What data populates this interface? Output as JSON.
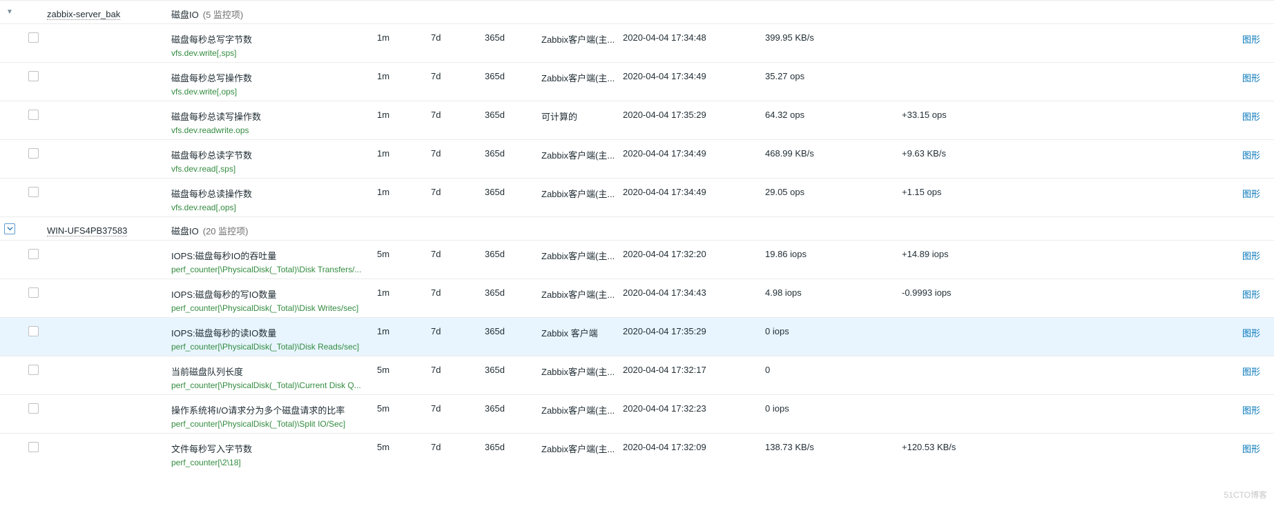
{
  "watermark": "51CTO博客",
  "labels": {
    "graph": "图形",
    "item_count_prefix": "(",
    "item_count_suffix": " 监控项)"
  },
  "groups": [
    {
      "host": "zabbix-server_bak",
      "app": "磁盘IO",
      "count": 5,
      "expanded_boxed": false,
      "items": [
        {
          "name": "磁盘每秒总写字节数",
          "key": "vfs.dev.write[,sps]",
          "interval": "1m",
          "history": "7d",
          "trends": "365d",
          "type": "Zabbix客户端(主...",
          "lastcheck": "2020-04-04 17:34:48",
          "lastvalue": "399.95 KB/s",
          "change": "",
          "highlight": false
        },
        {
          "name": "磁盘每秒总写操作数",
          "key": "vfs.dev.write[,ops]",
          "interval": "1m",
          "history": "7d",
          "trends": "365d",
          "type": "Zabbix客户端(主...",
          "lastcheck": "2020-04-04 17:34:49",
          "lastvalue": "35.27 ops",
          "change": "",
          "highlight": false
        },
        {
          "name": "磁盘每秒总读写操作数",
          "key": "vfs.dev.readwrite.ops",
          "interval": "1m",
          "history": "7d",
          "trends": "365d",
          "type": "可计算的",
          "lastcheck": "2020-04-04 17:35:29",
          "lastvalue": "64.32 ops",
          "change": "+33.15 ops",
          "highlight": false
        },
        {
          "name": "磁盘每秒总读字节数",
          "key": "vfs.dev.read[,sps]",
          "interval": "1m",
          "history": "7d",
          "trends": "365d",
          "type": "Zabbix客户端(主...",
          "lastcheck": "2020-04-04 17:34:49",
          "lastvalue": "468.99 KB/s",
          "change": "+9.63 KB/s",
          "highlight": false
        },
        {
          "name": "磁盘每秒总读操作数",
          "key": "vfs.dev.read[,ops]",
          "interval": "1m",
          "history": "7d",
          "trends": "365d",
          "type": "Zabbix客户端(主...",
          "lastcheck": "2020-04-04 17:34:49",
          "lastvalue": "29.05 ops",
          "change": "+1.15 ops",
          "highlight": false
        }
      ]
    },
    {
      "host": "WIN-UFS4PB37583",
      "app": "磁盘IO",
      "count": 20,
      "expanded_boxed": true,
      "items": [
        {
          "name": "IOPS:磁盘每秒IO的吞吐量",
          "key": "perf_counter[\\PhysicalDisk(_Total)\\Disk Transfers/...",
          "interval": "5m",
          "history": "7d",
          "trends": "365d",
          "type": "Zabbix客户端(主...",
          "lastcheck": "2020-04-04 17:32:20",
          "lastvalue": "19.86 iops",
          "change": "+14.89 iops",
          "highlight": false
        },
        {
          "name": "IOPS:磁盘每秒的写IO数量",
          "key": "perf_counter[\\PhysicalDisk(_Total)\\Disk Writes/sec]",
          "interval": "1m",
          "history": "7d",
          "trends": "365d",
          "type": "Zabbix客户端(主...",
          "lastcheck": "2020-04-04 17:34:43",
          "lastvalue": "4.98 iops",
          "change": "-0.9993 iops",
          "highlight": false
        },
        {
          "name": "IOPS:磁盘每秒的读IO数量",
          "key": "perf_counter[\\PhysicalDisk(_Total)\\Disk Reads/sec]",
          "interval": "1m",
          "history": "7d",
          "trends": "365d",
          "type": "Zabbix 客户端",
          "lastcheck": "2020-04-04 17:35:29",
          "lastvalue": "0 iops",
          "change": "",
          "highlight": true
        },
        {
          "name": "当前磁盘队列长度",
          "key": "perf_counter[\\PhysicalDisk(_Total)\\Current Disk Q...",
          "interval": "5m",
          "history": "7d",
          "trends": "365d",
          "type": "Zabbix客户端(主...",
          "lastcheck": "2020-04-04 17:32:17",
          "lastvalue": "0",
          "change": "",
          "highlight": false
        },
        {
          "name": "操作系统将I/O请求分为多个磁盘请求的比率",
          "key": "perf_counter[\\PhysicalDisk(_Total)\\Split IO/Sec]",
          "interval": "5m",
          "history": "7d",
          "trends": "365d",
          "type": "Zabbix客户端(主...",
          "lastcheck": "2020-04-04 17:32:23",
          "lastvalue": "0 iops",
          "change": "",
          "highlight": false
        },
        {
          "name": "文件每秒写入字节数",
          "key": "perf_counter[\\2\\18]",
          "interval": "5m",
          "history": "7d",
          "trends": "365d",
          "type": "Zabbix客户端(主...",
          "lastcheck": "2020-04-04 17:32:09",
          "lastvalue": "138.73 KB/s",
          "change": "+120.53 KB/s",
          "highlight": false
        }
      ]
    }
  ]
}
